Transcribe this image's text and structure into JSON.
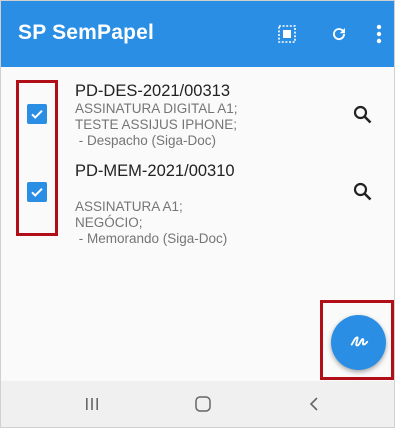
{
  "app": {
    "title": "SP SemPapel"
  },
  "toolbar": {
    "select_all_icon": "select-all-icon",
    "refresh_icon": "refresh-icon",
    "more_icon": "more-vert-icon"
  },
  "documents": [
    {
      "code": "PD-DES-2021/00313",
      "lines": [
        "ASSINATURA DIGITAL A1;",
        "TESTE ASSIJUS IPHONE;",
        " - Despacho (Siga-Doc)"
      ],
      "checked": true
    },
    {
      "code": "PD-MEM-2021/00310",
      "lines": [
        "ASSINATURA A1;",
        "NEGÓCIO;",
        " - Memorando (Siga-Doc)"
      ],
      "checked": true
    }
  ],
  "fab": {
    "icon": "signature-icon"
  },
  "navbar": {
    "recents_icon": "recents-icon",
    "home_icon": "home-icon",
    "back_icon": "back-icon"
  },
  "colors": {
    "primary": "#2a8ee4",
    "highlight": "#b10f18",
    "text": "#222222",
    "subtext": "#757575"
  }
}
